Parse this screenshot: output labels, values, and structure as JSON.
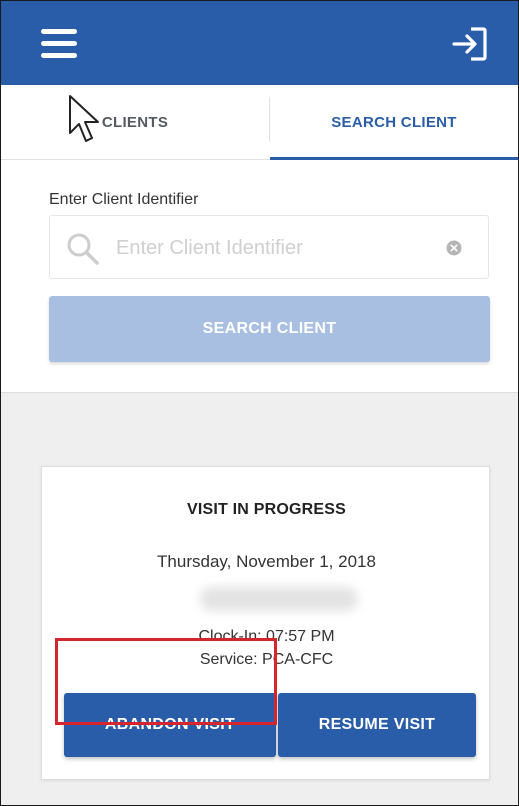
{
  "colors": {
    "brand_blue": "#2a5da9",
    "disabled_blue": "#a9bfe2",
    "highlight_red": "#d6262d",
    "background_grey": "#efefef"
  },
  "header": {
    "menu_icon": "hamburger-menu-icon",
    "logout_icon": "sign-out-icon"
  },
  "tabs": [
    {
      "label": "CLIENTS",
      "active": false
    },
    {
      "label": "SEARCH CLIENT",
      "active": true
    }
  ],
  "search": {
    "field_label": "Enter Client Identifier",
    "placeholder": "Enter Client Identifier",
    "value": "",
    "button_label": "SEARCH CLIENT",
    "search_icon": "magnifier-icon",
    "clear_icon": "clear-x-icon"
  },
  "visit": {
    "title": "VISIT IN PROGRESS",
    "date": "Thursday, November 1, 2018",
    "clock_in": "Clock-In: 07:57 PM",
    "service": "Service: PCA-CFC",
    "abandon_label": "ABANDON VISIT",
    "resume_label": "RESUME VISIT"
  }
}
